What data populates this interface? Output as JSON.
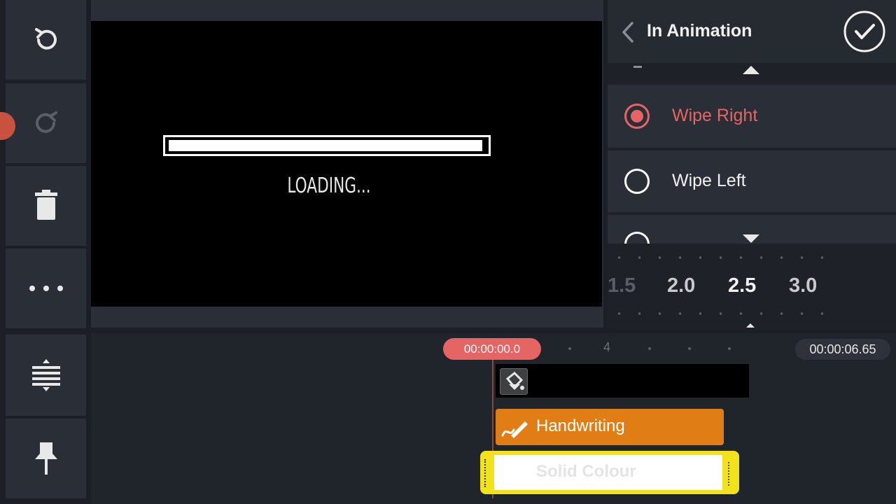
{
  "toolbar": {
    "undo_icon": "undo-icon",
    "redo_icon": "redo-icon",
    "delete_icon": "trash-icon",
    "more_icon": "more-icon",
    "split_icon": "split-icon",
    "pin_icon": "pin-icon"
  },
  "preview": {
    "loading_text": "LOADING...",
    "progress": 1.0
  },
  "panel": {
    "title": "In Animation",
    "options": [
      {
        "label": "Wipe Right",
        "selected": true
      },
      {
        "label": "Wipe Left",
        "selected": false
      }
    ],
    "duration_values": [
      "1.5",
      "2.0",
      "2.5",
      "3.0"
    ],
    "selected_duration": "2.5"
  },
  "timeline": {
    "current_time": "00:00:00.0",
    "total_time": "00:00:06.65",
    "ruler_mark": "4",
    "clips": [
      {
        "label": "Handwriting",
        "color": "#e07d15"
      },
      {
        "label": "Solid Colour",
        "color": "#f2e21b"
      }
    ]
  },
  "colors": {
    "accent": "#e46564",
    "background": "#1c2026"
  }
}
